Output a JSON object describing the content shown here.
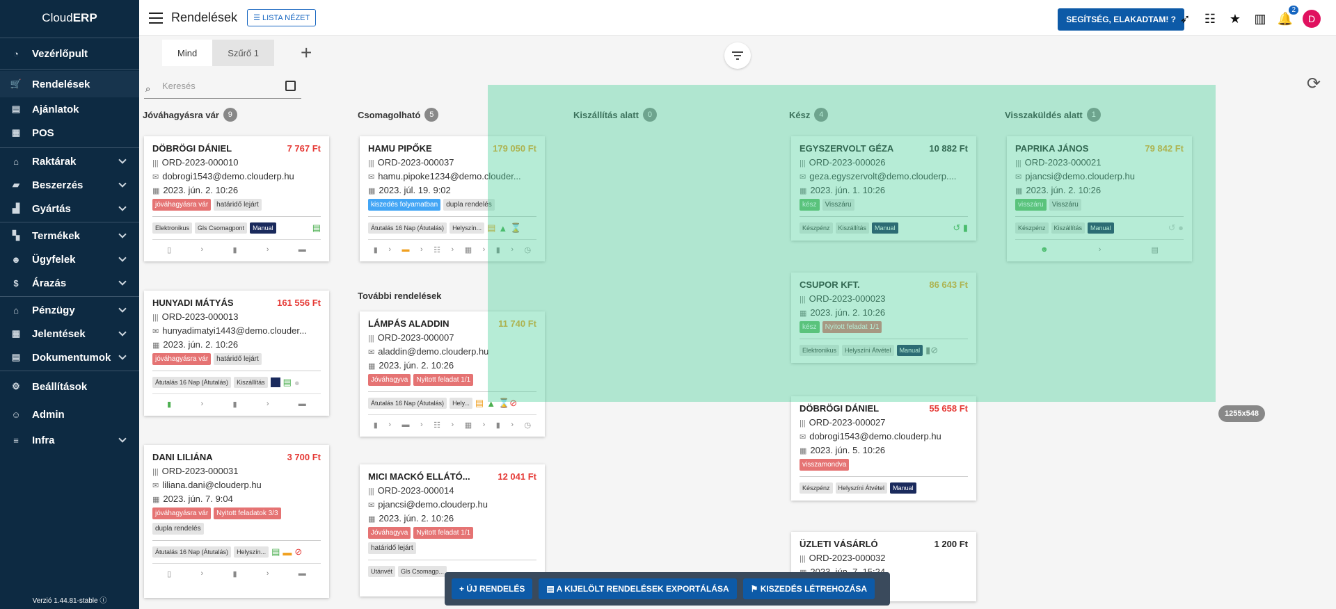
{
  "app": {
    "name_prefix": "Cloud",
    "name_bold": "ERP"
  },
  "sidebar": {
    "items": [
      {
        "label": "Vezérlőpult",
        "icon": "pie-chart-icon"
      },
      {
        "label": "Rendelések",
        "icon": "cart-icon"
      },
      {
        "label": "Ajánlatok",
        "icon": "document-icon"
      },
      {
        "label": "POS",
        "icon": "cash-register-icon"
      },
      {
        "label": "Raktárak",
        "icon": "warehouse-icon"
      },
      {
        "label": "Beszerzés",
        "icon": "truck-icon"
      },
      {
        "label": "Gyártás",
        "icon": "industry-icon"
      },
      {
        "label": "Termékek",
        "icon": "boxes-icon"
      },
      {
        "label": "Ügyfelek",
        "icon": "users-icon"
      },
      {
        "label": "Árazás",
        "icon": "dollar-icon"
      },
      {
        "label": "Pénzügy",
        "icon": "bank-icon"
      },
      {
        "label": "Jelentések",
        "icon": "table-icon"
      },
      {
        "label": "Dokumentumok",
        "icon": "file-icon"
      },
      {
        "label": "Beállítások",
        "icon": "gear-icon"
      },
      {
        "label": "Admin",
        "icon": "user-cog-icon"
      },
      {
        "label": "Infra",
        "icon": "server-icon"
      }
    ],
    "version": "Verzió 1.44.81-stable"
  },
  "header": {
    "title": "Rendelések",
    "list_view": "LISTA NÉZET",
    "help": "SEGÍTSÉG, ELAKADTAM!",
    "notif_count": "2",
    "avatar": "D"
  },
  "tabs": [
    "Mind",
    "Szűrő 1"
  ],
  "search": {
    "placeholder": "Keresés"
  },
  "columns": [
    {
      "title": "Jóváhagyásra vár",
      "count": "9"
    },
    {
      "title": "Csomagolható",
      "count": "5"
    },
    {
      "title": "Kiszállítás alatt",
      "count": "0"
    },
    {
      "title": "Kész",
      "count": "4"
    },
    {
      "title": "Visszaküldés alatt",
      "count": "1"
    }
  ],
  "more_orders": "További rendelések",
  "cards": {
    "c1": {
      "name": "DÖBRÖGI DÁNIEL",
      "price": "7 767 Ft",
      "ord": "ORD-2023-000010",
      "email": "dobrogi1543@demo.clouderp.hu",
      "date": "2023. jún. 2. 10:26",
      "tags": [
        "jóváhagyásra vár",
        "határidő lejárt"
      ],
      "meta": [
        "Elektronikus",
        "Gls Csomagpont",
        "Manual"
      ]
    },
    "c2": {
      "name": "HUNYADI MÁTYÁS",
      "price": "161 556 Ft",
      "ord": "ORD-2023-000013",
      "email": "hunyadimatyi1443@demo.clouder...",
      "date": "2023. jún. 2. 10:26",
      "tags": [
        "jóváhagyásra vár",
        "határidő lejárt"
      ],
      "meta": [
        "Átutalás 16 Nap (Átutalás)",
        "Kiszállítás"
      ]
    },
    "c3": {
      "name": "DANI LILIÁNA",
      "price": "3 700 Ft",
      "ord": "ORD-2023-000031",
      "email": "liliana.dani@clouderp.hu",
      "date": "2023. jún. 7. 9:04",
      "tags": [
        "jóváhagyásra vár",
        "Nyitott feladatok 3/3",
        "dupla rendelés"
      ],
      "meta": [
        "Átutalás 16 Nap (Átutalás)",
        "Helyszín..."
      ]
    },
    "c4": {
      "name": "HAMU PIPŐKE",
      "price": "179 050 Ft",
      "ord": "ORD-2023-000037",
      "email": "hamu.pipoke1234@demo.clouder...",
      "date": "2023. júl. 19. 9:02",
      "tags": [
        "kiszedés folyamatban",
        "dupla rendelés"
      ],
      "meta": [
        "Átutalás 16 Nap (Átutalás)",
        "Helyszín..."
      ]
    },
    "c5": {
      "name": "LÁMPÁS ALADDIN",
      "price": "11 740 Ft",
      "ord": "ORD-2023-000007",
      "email": "aladdin@demo.clouderp.hu",
      "date": "2023. jún. 2. 10:26",
      "tags": [
        "Jóváhagyva",
        "Nyitott feladat 1/1"
      ],
      "meta": [
        "Átutalás 16 Nap (Átutalás)",
        "Hely..."
      ]
    },
    "c6": {
      "name": "MICI MACKÓ ELLÁTÓ...",
      "price": "12 041 Ft",
      "ord": "ORD-2023-000014",
      "email": "pjancsi@demo.clouderp.hu",
      "date": "2023. jún. 2. 10:26",
      "tags": [
        "Jóváhagyva",
        "Nyitott feladat 1/1",
        "határidő lejárt"
      ],
      "meta": [
        "Utánvét",
        "Gls Csomagp..."
      ]
    },
    "c7": {
      "name": "EGYSZERVOLT GÉZA",
      "price": "10 882 Ft",
      "ord": "ORD-2023-000026",
      "email": "geza.egyszervolt@demo.clouderp....",
      "date": "2023. jún. 1. 10:26",
      "tags": [
        "kész",
        "Visszáru"
      ],
      "meta": [
        "Készpénz",
        "Kiszállítás",
        "Manual"
      ]
    },
    "c8": {
      "name": "CSUPOR KFT.",
      "price": "86 643 Ft",
      "ord": "ORD-2023-000023",
      "email": "",
      "date": "2023. jún. 2. 10:26",
      "tags": [
        "kész",
        "Nyitott feladat 1/1"
      ],
      "meta": [
        "Elektronikus",
        "Helyszíni Átvétel",
        "Manual"
      ]
    },
    "c9": {
      "name": "DÖBRÖGI DÁNIEL",
      "price": "55 658 Ft",
      "ord": "ORD-2023-000027",
      "email": "dobrogi1543@demo.clouderp.hu",
      "date": "2023. jún. 5. 10:26",
      "tags": [
        "visszamondva"
      ],
      "meta": [
        "Készpénz",
        "Helyszíni Átvétel",
        "Manual"
      ]
    },
    "c10": {
      "name": "ÜZLETI VÁSÁRLÓ",
      "price": "1 200 Ft",
      "ord": "ORD-2023-000032",
      "date": "2023. jún. 7. 15:24"
    },
    "c11": {
      "name": "PAPRIKA JÁNOS",
      "price": "79 842 Ft",
      "ord": "ORD-2023-000021",
      "email": "pjancsi@demo.clouderp.hu",
      "date": "2023. jún. 2. 10:26",
      "tags": [
        "visszáru",
        "Visszáru"
      ],
      "meta": [
        "Készpénz",
        "Kiszállítás",
        "Manual"
      ]
    }
  },
  "overlay_label": "1255x548",
  "bottom_actions": [
    "+ ÚJ RENDELÉS",
    "A KIJELÖLT RENDELÉSEK EXPORTÁLÁSA",
    "KISZEDÉS LÉTREHOZÁSA"
  ]
}
